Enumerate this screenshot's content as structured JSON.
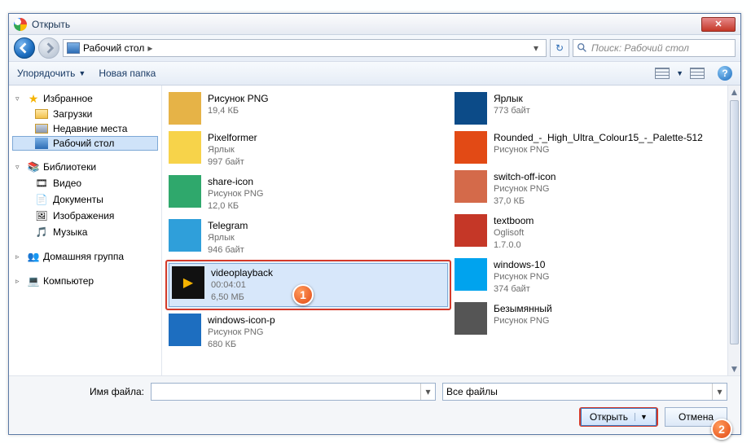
{
  "window": {
    "title": "Открыть"
  },
  "nav": {
    "location": "Рабочий стол",
    "separator": "▸",
    "dropdown": "▾",
    "search_placeholder": "Поиск: Рабочий стол"
  },
  "toolbar": {
    "organize": "Упорядочить",
    "new_folder": "Новая папка",
    "help": "?"
  },
  "sidebar": {
    "favorites": {
      "label": "Избранное",
      "items": [
        "Загрузки",
        "Недавние места",
        "Рабочий стол"
      ]
    },
    "libraries": {
      "label": "Библиотеки",
      "items": [
        "Видео",
        "Документы",
        "Изображения",
        "Музыка"
      ]
    },
    "homegroup": {
      "label": "Домашняя группа"
    },
    "computer": {
      "label": "Компьютер"
    }
  },
  "files": {
    "left": [
      {
        "name": "Рисунок PNG",
        "sub": "",
        "size": "19,4 КБ"
      },
      {
        "name": "Pixelformer",
        "sub": "Ярлык",
        "size": "997 байт"
      },
      {
        "name": "share-icon",
        "sub": "Рисунок PNG",
        "size": "12,0 КБ"
      },
      {
        "name": "Telegram",
        "sub": "Ярлык",
        "size": "946 байт"
      },
      {
        "name": "videoplayback",
        "sub": "00:04:01",
        "size": "6,50 МБ",
        "selected": true
      },
      {
        "name": "windows-icon-p",
        "sub": "Рисунок PNG",
        "size": "680 КБ"
      }
    ],
    "right": [
      {
        "name": "Ярлык",
        "sub": "",
        "size": "773 байт"
      },
      {
        "name": "Rounded_-_High_Ultra_Colour15_-_Palette-512",
        "sub": "Рисунок PNG",
        "size": ""
      },
      {
        "name": "switch-off-icon",
        "sub": "Рисунок PNG",
        "size": "37,0 КБ"
      },
      {
        "name": "textboom",
        "sub": "Oglisoft",
        "size": "1.7.0.0"
      },
      {
        "name": "windows-10",
        "sub": "Рисунок PNG",
        "size": "374 байт"
      },
      {
        "name": "Безымянный",
        "sub": "Рисунок PNG",
        "size": ""
      }
    ]
  },
  "bottom": {
    "filename_label": "Имя файла:",
    "filename_value": "",
    "filter": "Все файлы",
    "open": "Открыть",
    "cancel": "Отмена"
  },
  "callouts": {
    "c1": "1",
    "c2": "2"
  }
}
